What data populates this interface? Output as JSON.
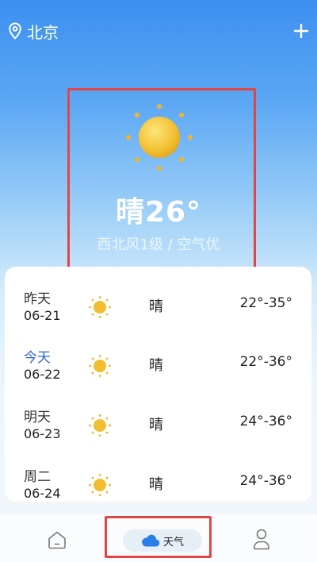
{
  "header": {
    "location": "北京",
    "add_icon": "plus-icon",
    "location_icon": "map-pin-icon"
  },
  "current": {
    "icon": "sun-icon",
    "temperature": "晴26°",
    "detail": "西北风1级 / 空气优"
  },
  "forecast": [
    {
      "day": "昨天",
      "date": "06-21",
      "icon": "sun-icon",
      "condition": "晴",
      "range": "22°-35°"
    },
    {
      "day": "今天",
      "date": "06-22",
      "icon": "sun-icon",
      "condition": "晴",
      "range": "22°-36°"
    },
    {
      "day": "明天",
      "date": "06-23",
      "icon": "sun-icon",
      "condition": "晴",
      "range": "24°-36°"
    },
    {
      "day": "周二",
      "date": "06-24",
      "icon": "sun-icon",
      "condition": "晴",
      "range": "24°-36°"
    }
  ],
  "nav": {
    "home_icon": "home-icon",
    "weather_icon": "cloud-icon",
    "weather_label": "天气",
    "profile_icon": "user-icon"
  },
  "colors": {
    "highlight": "#e04646",
    "today": "#2a5fd8",
    "sky_top": "#3d8ff0"
  }
}
